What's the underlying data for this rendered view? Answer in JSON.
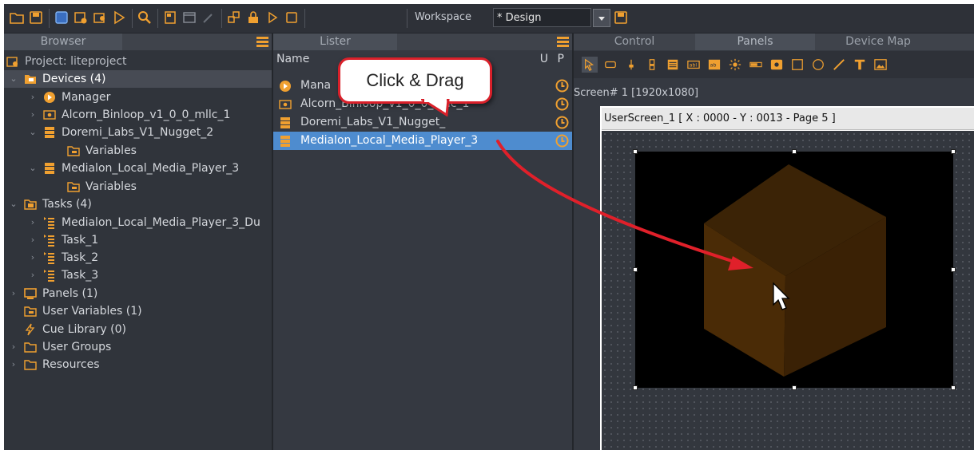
{
  "toolbar": {
    "workspace_label": "Workspace",
    "workspace_value": "* Design"
  },
  "browser": {
    "header": "Browser",
    "items": [
      {
        "label": "Project: liteproject"
      },
      {
        "label": "Devices (4)"
      },
      {
        "label": "Manager"
      },
      {
        "label": "Alcorn_Binloop_v1_0_0_mllc_1"
      },
      {
        "label": "Doremi_Labs_V1_Nugget_2"
      },
      {
        "label": "Variables"
      },
      {
        "label": "Medialon_Local_Media_Player_3"
      },
      {
        "label": "Variables"
      },
      {
        "label": "Tasks (4)"
      },
      {
        "label": "Medialon_Local_Media_Player_3_Du"
      },
      {
        "label": "Task_1"
      },
      {
        "label": "Task_2"
      },
      {
        "label": "Task_3"
      },
      {
        "label": "Panels (1)"
      },
      {
        "label": "User Variables (1)"
      },
      {
        "label": "Cue Library (0)"
      },
      {
        "label": "User Groups"
      },
      {
        "label": "Resources"
      }
    ]
  },
  "lister": {
    "header": "Lister",
    "col_name": "Name",
    "col_u": "U",
    "col_p": "P",
    "rows": [
      {
        "label": "Mana"
      },
      {
        "label": "Alcorn_Binloop_v1_0_0_mllc_1"
      },
      {
        "label": "Doremi_Labs_V1_Nugget_"
      },
      {
        "label": "Medialon_Local_Media_Player_3"
      }
    ]
  },
  "right": {
    "tabs": [
      "Control",
      "Panels",
      "Device Map"
    ],
    "screen_label": "Screen# 1 [1920x1080]",
    "canvas_title": "UserScreen_1 [ X : 0000 - Y : 0013 - Page 5 ]"
  },
  "callout": {
    "text": "Click & Drag"
  },
  "colors": {
    "accent_orange": "#f0a030",
    "selection_blue": "#4e8ccf",
    "callout_red": "#d9202a",
    "arrow_red": "#e0202a"
  }
}
